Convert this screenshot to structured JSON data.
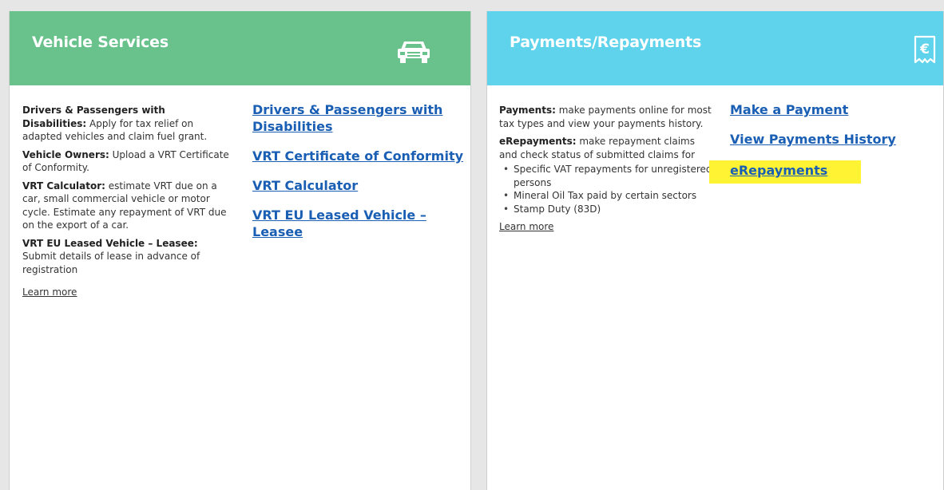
{
  "vehicle": {
    "title": "Vehicle Services",
    "header_icon": "car-icon",
    "header_color": "#69c18b",
    "descriptions": [
      {
        "bold": "Drivers & Passengers with Disabilities:",
        "text": " Apply for tax relief on adapted vehicles and claim fuel grant."
      },
      {
        "bold": "Vehicle Owners:",
        "text": " Upload a VRT Certificate of Conformity."
      },
      {
        "bold": "VRT Calculator:",
        "text": " estimate VRT due on a car, small commercial vehicle or motor cycle. Estimate any repayment of VRT due on the export of a car."
      },
      {
        "bold": "VRT EU Leased Vehicle – Leasee:",
        "text": " Submit details of lease in advance of registration"
      }
    ],
    "learn_more": "Learn more",
    "links": [
      "Drivers & Passengers with Disabilities",
      "VRT Certificate of Conformity",
      "VRT Calculator",
      "VRT EU Leased Vehicle – Leasee"
    ]
  },
  "payments": {
    "title": "Payments/Repayments",
    "header_icon": "euro-receipt-icon",
    "header_color": "#5fd3ec",
    "descriptions": [
      {
        "bold": "Payments:",
        "text": " make payments online for most tax types and view your payments history."
      },
      {
        "bold": "eRepayments:",
        "text": " make repayment claims and check status of submitted claims for"
      }
    ],
    "bullets": [
      "Specific VAT repayments for unregistered persons",
      "Mineral Oil Tax paid by certain sectors",
      "Stamp Duty (83D)"
    ],
    "learn_more": "Learn more",
    "links": [
      "Make a Payment",
      "View Payments History",
      "eRepayments"
    ],
    "highlight_color": "#fff333"
  },
  "link_color": "#1a5fb4"
}
